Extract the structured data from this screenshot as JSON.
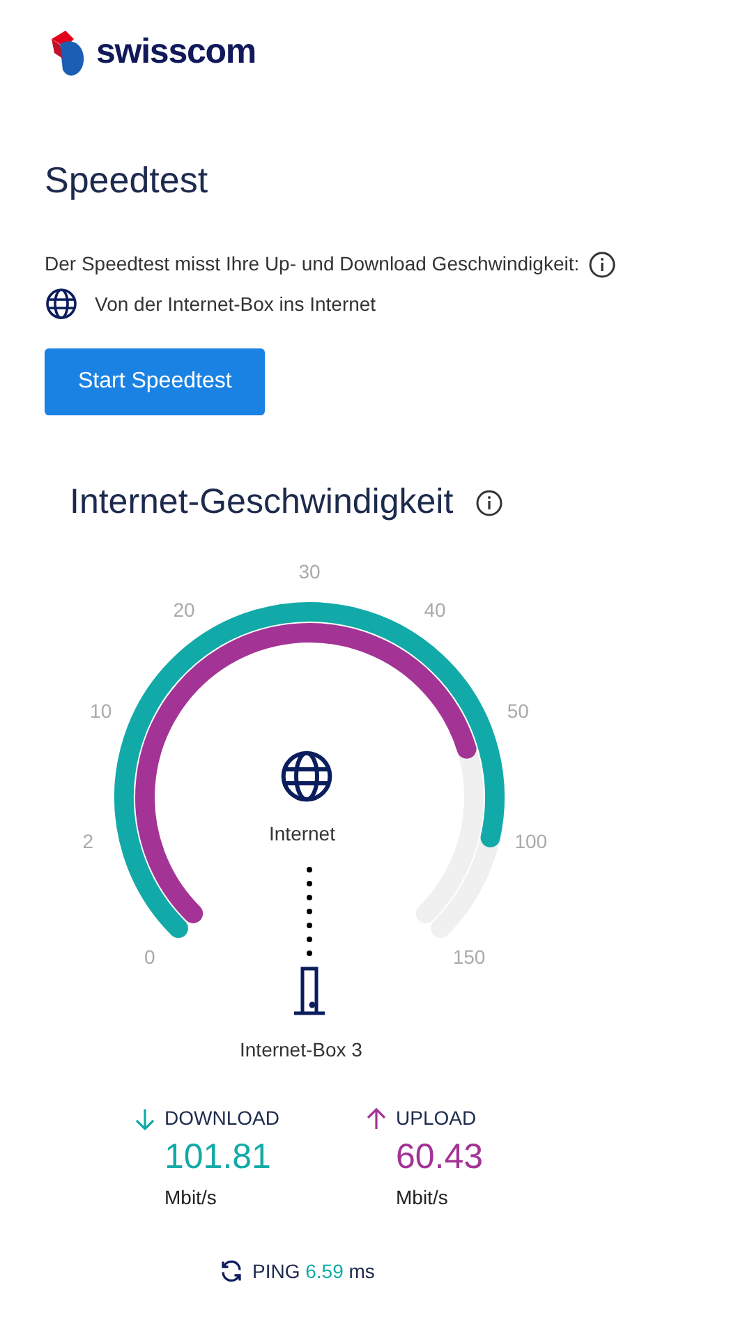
{
  "logo": {
    "text": "swisscom"
  },
  "title": "Speedtest",
  "description": "Der Speedtest misst Ihre Up- und Download Geschwindigkeit:",
  "route": "Von der Internet-Box ins Internet",
  "start_button": "Start Speedtest",
  "gauge": {
    "title": "Internet-Geschwindigkeit",
    "ticks": [
      "0",
      "2",
      "10",
      "20",
      "30",
      "40",
      "50",
      "100",
      "150"
    ],
    "top_node": "Internet",
    "bottom_node": "Internet-Box 3"
  },
  "results": [
    {
      "kind": "download",
      "label": "DOWNLOAD",
      "value": "101.81",
      "unit": "Mbit/s",
      "color": "#12aaa8"
    },
    {
      "kind": "upload",
      "label": "UPLOAD",
      "value": "60.43",
      "unit": "Mbit/s",
      "color": "#a33495"
    }
  ],
  "ping": {
    "label": "PING",
    "value": "6.59",
    "unit": "ms"
  }
}
